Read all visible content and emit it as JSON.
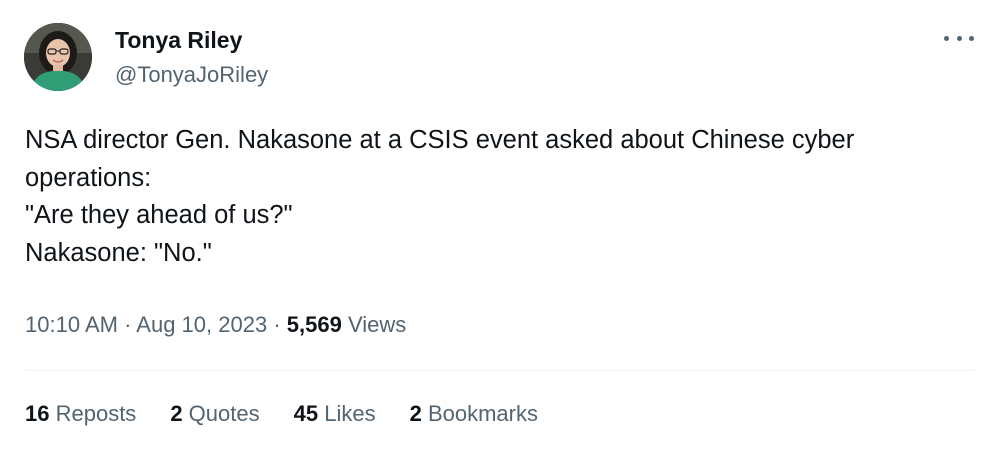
{
  "author": {
    "name": "Tonya Riley",
    "handle": "@TonyaJoRiley"
  },
  "tweet": {
    "lines": [
      "NSA director Gen. Nakasone at a CSIS event asked about Chinese cyber",
      "operations:",
      "\"Are they ahead of us?\"",
      "Nakasone: \"No.\""
    ]
  },
  "meta": {
    "time": "10:10 AM",
    "sep1": " · ",
    "date": "Aug 10, 2023",
    "sep2": " · ",
    "views_count": "5,569",
    "views_label": " Views"
  },
  "stats": {
    "reposts_count": "16",
    "reposts_label": " Reposts",
    "quotes_count": "2",
    "quotes_label": " Quotes",
    "likes_count": "45",
    "likes_label": " Likes",
    "bookmarks_count": "2",
    "bookmarks_label": " Bookmarks"
  },
  "icons": {
    "more": "more-options-icon"
  },
  "colors": {
    "text_primary": "#0f1419",
    "text_secondary": "#536471",
    "divider": "#eff3f4",
    "avatar_shirt": "#2f9e77"
  }
}
